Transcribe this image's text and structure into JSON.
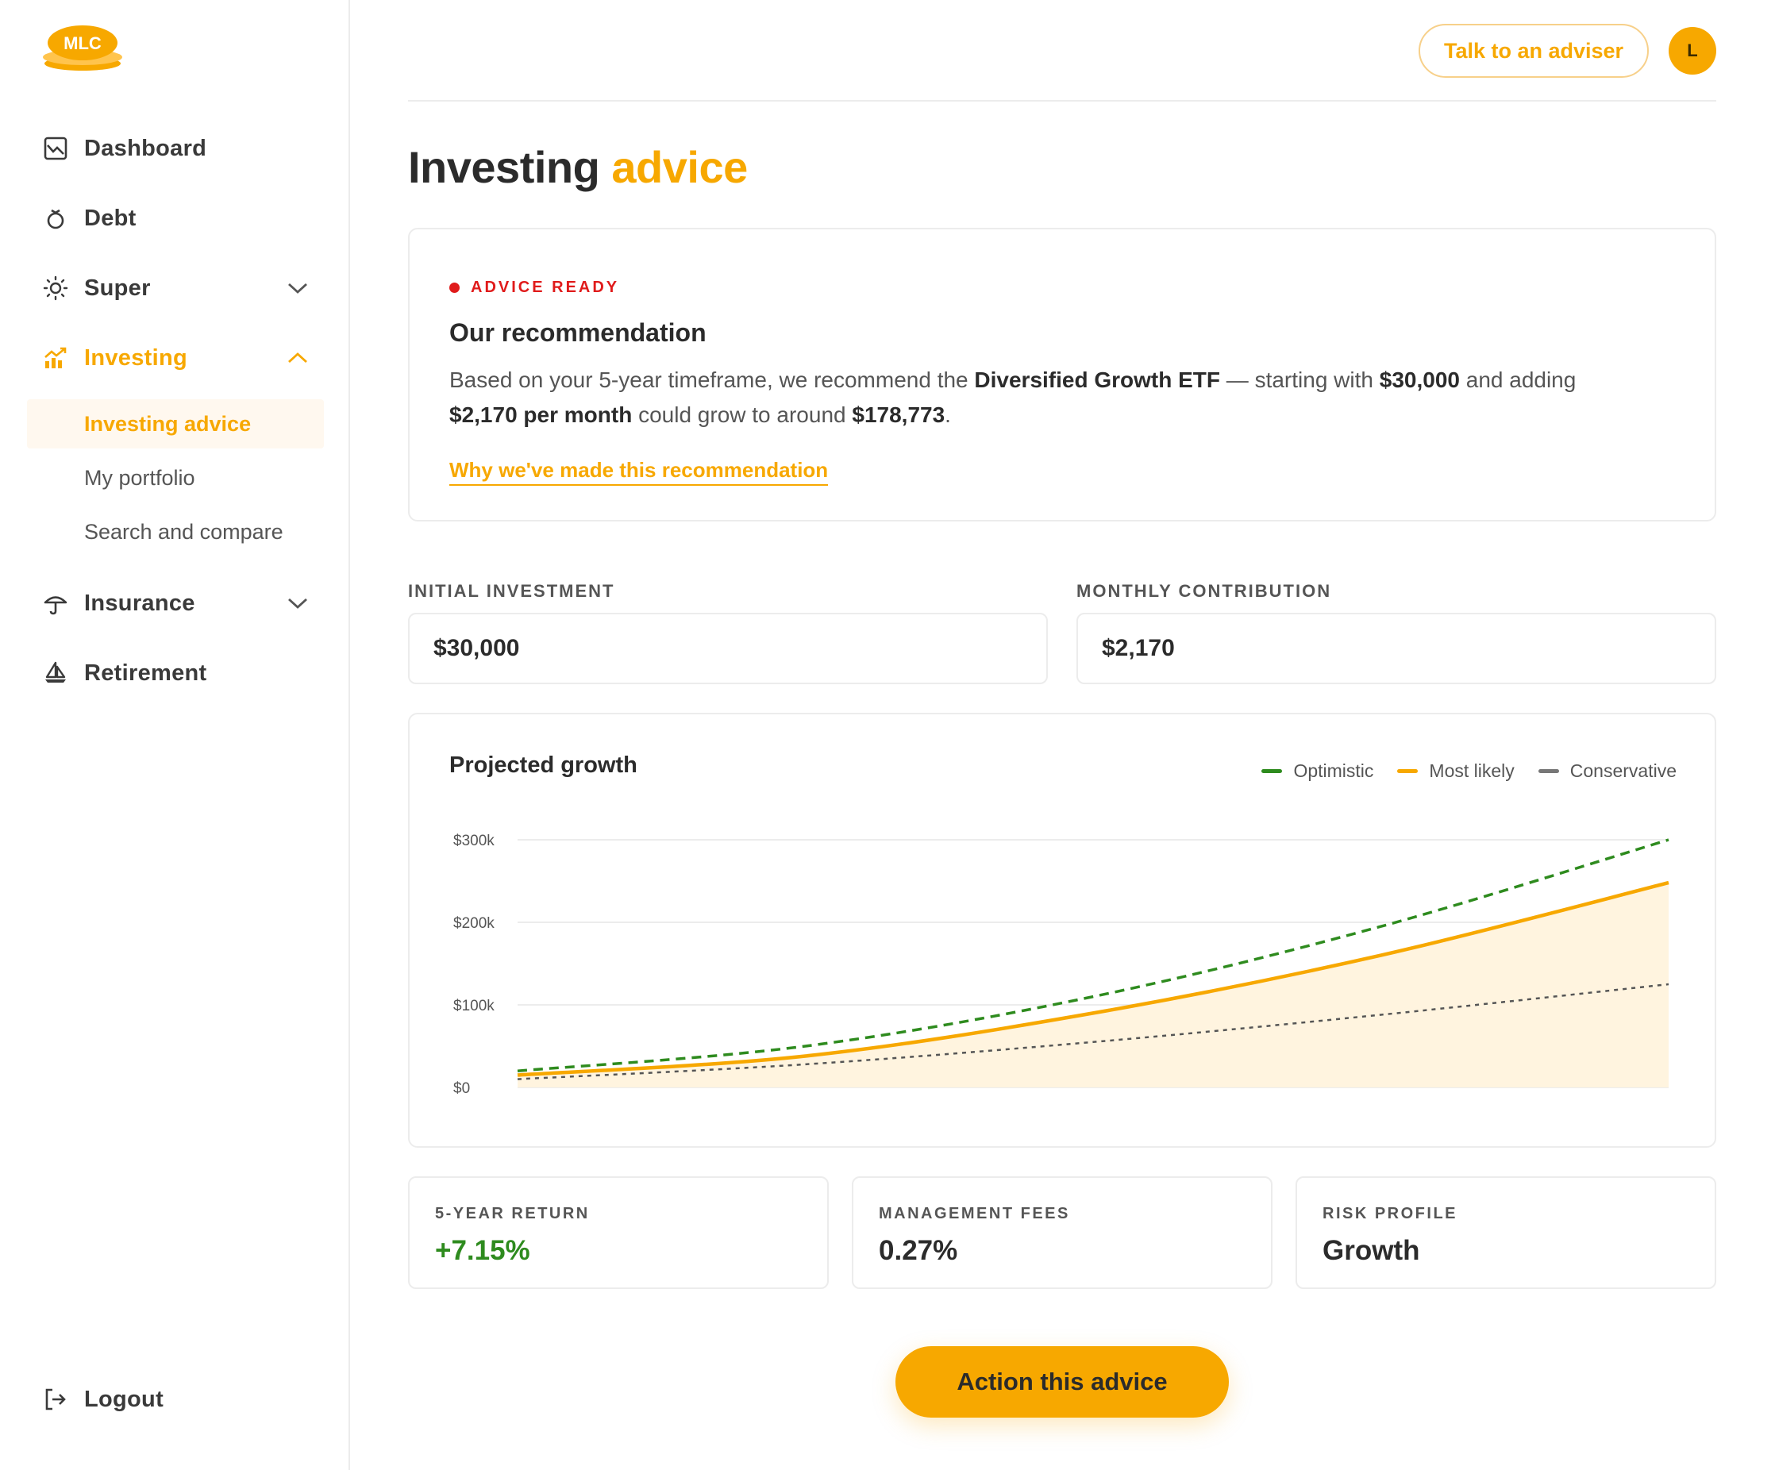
{
  "app": {
    "logo_text": "MLC"
  },
  "sidebar": {
    "items": [
      {
        "label": "Dashboard",
        "icon": "chart-frame-icon"
      },
      {
        "label": "Debt",
        "icon": "ring-icon"
      },
      {
        "label": "Super",
        "icon": "sun-icon"
      },
      {
        "label": "Investing",
        "icon": "growth-icon"
      },
      {
        "label": "Insurance",
        "icon": "umbrella-icon"
      },
      {
        "label": "Retirement",
        "icon": "sailboat-icon"
      }
    ],
    "sub_items": [
      {
        "label": "Investing advice"
      },
      {
        "label": "My portfolio"
      },
      {
        "label": "Search and compare"
      }
    ],
    "logout_label": "Logout"
  },
  "header": {
    "adviser_button": "Talk to an adviser",
    "avatar_initial": "L"
  },
  "page": {
    "title_main": "Investing",
    "title_accent": "advice"
  },
  "recommendation": {
    "badge": "ADVICE READY",
    "title": "Our recommendation",
    "text_1": "Based on your 5-year timeframe, we recommend the ",
    "fund": "Diversified Growth ETF",
    "text_2": " — starting with ",
    "initial": "$30,000",
    "text_3": " and adding ",
    "monthly": "$2,170 per month",
    "text_4": " could grow to around ",
    "projected": "$178,773",
    "text_5": ".",
    "link": "Why we've made this recommendation"
  },
  "inputs": {
    "initial_label": "INITIAL INVESTMENT",
    "initial_value": "$30,000",
    "monthly_label": "MONTHLY CONTRIBUTION",
    "monthly_value": "$2,170"
  },
  "chart_data": {
    "type": "area",
    "title": "Projected growth",
    "yticks": [
      "$300k",
      "$200k",
      "$100k",
      "$0"
    ],
    "ylim": [
      0,
      300000
    ],
    "x": [
      0,
      0.25,
      0.5,
      0.75,
      1
    ],
    "series": [
      {
        "name": "Optimistic",
        "color": "#2e8b1e",
        "style": "dashed",
        "values": [
          20000,
          50000,
          110000,
          195000,
          300000
        ]
      },
      {
        "name": "Most likely",
        "color": "#f7a800",
        "style": "solid",
        "fill": true,
        "values": [
          15000,
          38000,
          90000,
          160000,
          248000
        ]
      },
      {
        "name": "Conservative",
        "color": "#555555",
        "style": "dotted",
        "values": [
          10000,
          28000,
          55000,
          88000,
          125000
        ]
      }
    ],
    "grid": true,
    "legend": "top-right"
  },
  "stats": [
    {
      "label": "5-YEAR RETURN",
      "value": "+7.15%",
      "color": "#2e8b1e"
    },
    {
      "label": "MANAGEMENT FEES",
      "value": "0.27%",
      "color": "#2b2b2b"
    },
    {
      "label": "RISK PROFILE",
      "value": "Growth",
      "color": "#2b2b2b"
    }
  ],
  "cta": {
    "label": "Action this advice"
  }
}
